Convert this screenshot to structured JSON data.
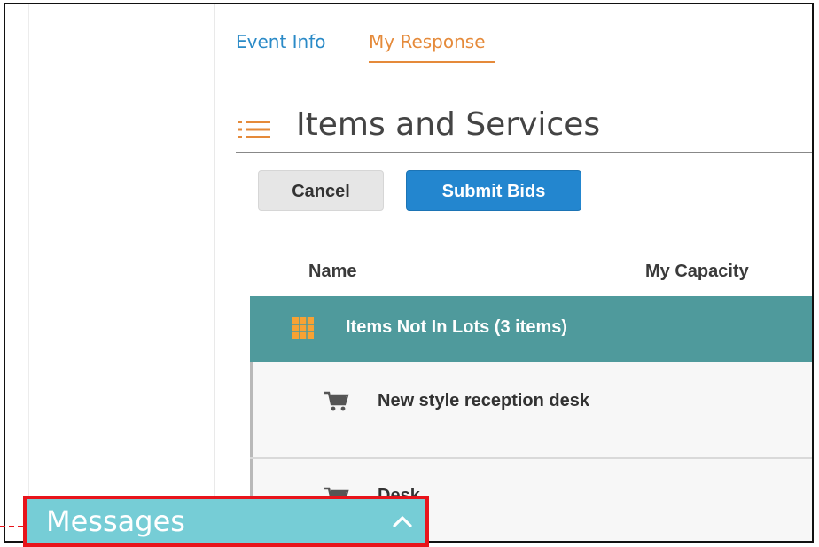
{
  "tabs": [
    {
      "label": "Event Info",
      "active": false
    },
    {
      "label": "My Response",
      "active": true
    }
  ],
  "section": {
    "title": "Items and Services",
    "icon": "list-icon"
  },
  "actions": {
    "cancel_label": "Cancel",
    "submit_label": "Submit Bids"
  },
  "table": {
    "columns": [
      "Name",
      "My Capacity"
    ],
    "group": {
      "label": "Items Not In Lots (3 items)",
      "icon": "grid-icon"
    },
    "items": [
      {
        "name": "New style reception desk",
        "icon": "cart-icon"
      },
      {
        "name": "Desk",
        "icon": "cart-icon"
      }
    ]
  },
  "messages": {
    "label": "Messages",
    "icon": "chevron-up-icon"
  },
  "colors": {
    "accent_orange": "#e58a3a",
    "link_blue": "#2a8ac7",
    "submit_blue": "#2386cf",
    "group_teal": "#4f9a9c",
    "messages_bg": "#76cdd6",
    "highlight_red": "#e8141b"
  }
}
